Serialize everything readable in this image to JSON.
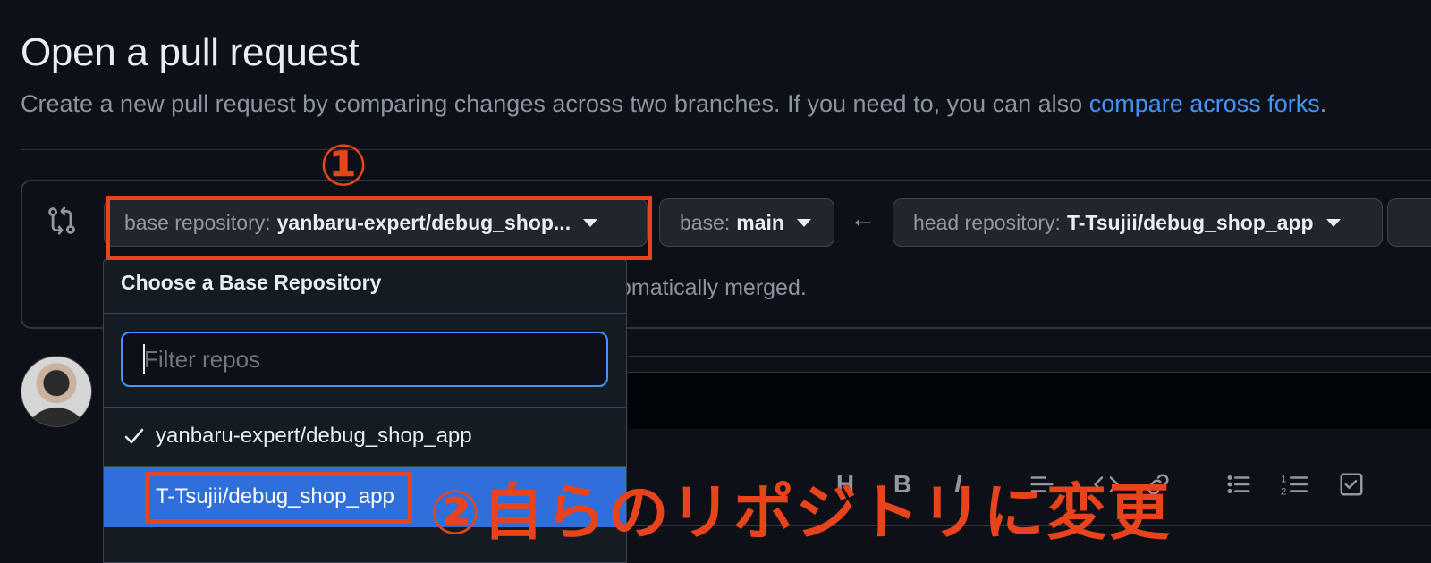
{
  "header": {
    "title": "Open a pull request",
    "subtitle": "Create a new pull request by comparing changes across two branches. If you need to, you can also",
    "subtitle_link": "compare across forks",
    "subtitle_end": "."
  },
  "compare": {
    "base_repo_label": "base repository:",
    "base_repo_value": "yanbaru-expert/debug_shop...",
    "base_branch_label": "base:",
    "base_branch_value": "main",
    "arrow": "←",
    "head_repo_label": "head repository:",
    "head_repo_value": "T-Tsujii/debug_shop_app",
    "merge_note": "omatically merged."
  },
  "dropdown": {
    "title": "Choose a Base Repository",
    "filter_placeholder": "Filter repos",
    "items": [
      {
        "label": "yanbaru-expert/debug_shop_app",
        "selected": true
      },
      {
        "label": "T-Tsujii/debug_shop_app",
        "selected": false,
        "highlighted": true
      }
    ]
  },
  "toolbar": {
    "heading": "H",
    "bold": "B",
    "italic": "I",
    "icons": [
      "heading-icon",
      "bold-icon",
      "italic-icon",
      "quote-icon",
      "code-icon",
      "link-icon",
      "unordered-list-icon",
      "ordered-list-icon",
      "task-list-icon"
    ]
  },
  "annotations": {
    "step1": "①",
    "step2": "②自らのリポジトリに変更",
    "color": "#e8431c"
  },
  "colors": {
    "background": "#0d1117",
    "link": "#4493f8",
    "highlight": "#2f6fdb"
  }
}
